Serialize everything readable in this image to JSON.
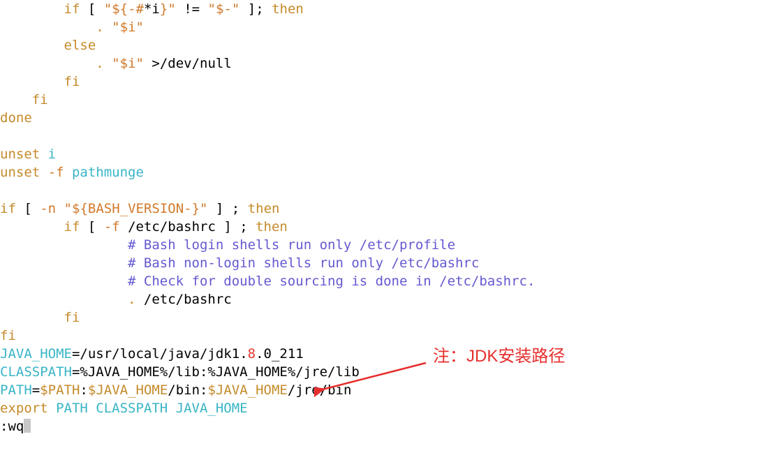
{
  "code": {
    "l1": {
      "indent": "        ",
      "kw": "if",
      "open": " [ ",
      "str_a": "\"$",
      "brace_open": "{",
      "opt": "-#",
      "starI": "*i",
      "brace_close": "}",
      "str_close": "\"",
      "ne": " != ",
      "str_dash_open": "\"",
      "dash": "$-",
      "str_dash_close": "\"",
      "close": " ]; ",
      "then": "then"
    },
    "l2": {
      "indent": "            ",
      "dot": ". ",
      "q1": "\"",
      "dollarI": "$i",
      "q2": "\""
    },
    "l3": {
      "indent": "        ",
      "kw": "else"
    },
    "l4": {
      "indent": "            ",
      "dot": ". ",
      "q1": "\"",
      "dollarI": "$i",
      "q2": "\"",
      "gt": " >",
      "devnull": "/dev/null"
    },
    "l5": {
      "indent": "        ",
      "kw": "fi"
    },
    "l6": {
      "indent": "    ",
      "kw": "fi"
    },
    "l7": {
      "kw": "done"
    },
    "blank1": "",
    "l8": {
      "unset": "unset ",
      "i": "i"
    },
    "l9": {
      "unset": "unset ",
      "flag": "-f ",
      "fn": "pathmunge"
    },
    "blank2": "",
    "l10": {
      "kw": "if",
      "open": " [ ",
      "n": "-n ",
      "q1": "\"",
      "var": "${BASH_VERSION-}",
      "q2": "\"",
      "close": " ] ; ",
      "then": "then"
    },
    "l11": {
      "indent": "        ",
      "kw": "if",
      "open": " [ ",
      "f": "-f ",
      "path": "/etc/bashrc",
      "close": " ] ; ",
      "then": "then"
    },
    "l12": {
      "indent": "                ",
      "cmt": "# Bash login shells run only /etc/profile"
    },
    "l13": {
      "indent": "                ",
      "cmt": "# Bash non-login shells run only /etc/bashrc"
    },
    "l14": {
      "indent": "                ",
      "cmt": "# Check for double sourcing is done in /etc/bashrc."
    },
    "l15": {
      "indent": "                ",
      "dot": ". ",
      "path": "/etc/bashrc"
    },
    "l16": {
      "indent": "        ",
      "kw": "fi"
    },
    "l17": {
      "kw": "fi"
    },
    "l18": {
      "var": "JAVA_HOME",
      "eq": "=",
      "p1": "/usr/local/java/jdk1",
      "dot1": ".",
      "eight": "8",
      "dot2": ".",
      "p2": "0_211"
    },
    "l19": {
      "var": "CLASSPATH",
      "eq": "=",
      "rest": "%JAVA_HOME%/lib:%JAVA_HOME%/jre/lib"
    },
    "l20": {
      "var": "PATH",
      "eq": "=",
      "r1": "$PATH",
      "colon1": ":",
      "r2": "$JAVA_HOME",
      "r3": "/bin",
      "colon2": ":",
      "r4": "$JAVA_HOME",
      "r5": "/jre/bin"
    },
    "l21": {
      "export": "export ",
      "vars": "PATH CLASSPATH JAVA_HOME"
    },
    "l22": {
      "cmd": ":wq"
    }
  },
  "annotation": {
    "text": "注：JDK安装路径"
  }
}
